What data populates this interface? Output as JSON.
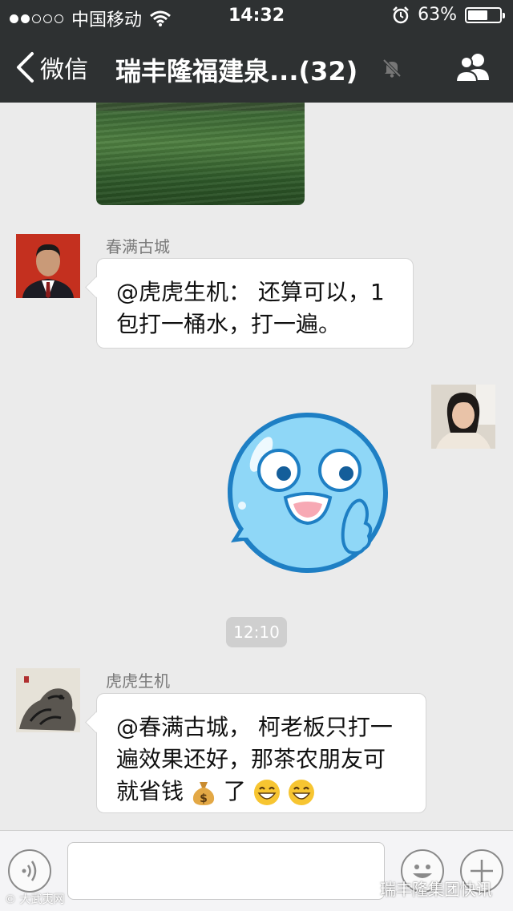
{
  "status_bar": {
    "carrier": "中国移动",
    "time": "14:32",
    "battery": "63%",
    "battery_level": 0.63,
    "signal_bars_filled": 2,
    "signal_bars_total": 5
  },
  "nav": {
    "back_label": "微信",
    "title": "瑞丰隆福建泉...(32)"
  },
  "messages": [
    {
      "sender": "春满古城",
      "lines": [
        "@虎虎生机： 还算可以，1",
        "包打一桶水，打一遍。"
      ]
    },
    {
      "sender": "虎虎生机",
      "lines": [
        "@春满古城， 柯老板只打一",
        "遍效果还好，那茶农朋友可",
        "就省钱"
      ],
      "tail": "了"
    }
  ],
  "timestamp": "12:10",
  "watermarks": {
    "left": "© 大武夷网",
    "right": "瑞丰隆集团快讯"
  },
  "colors": {
    "header_bg": "#2e3132",
    "chat_bg": "#ebebeb",
    "sticker_blue": "#8fd7f7",
    "sticker_outline": "#1e7fc4"
  }
}
